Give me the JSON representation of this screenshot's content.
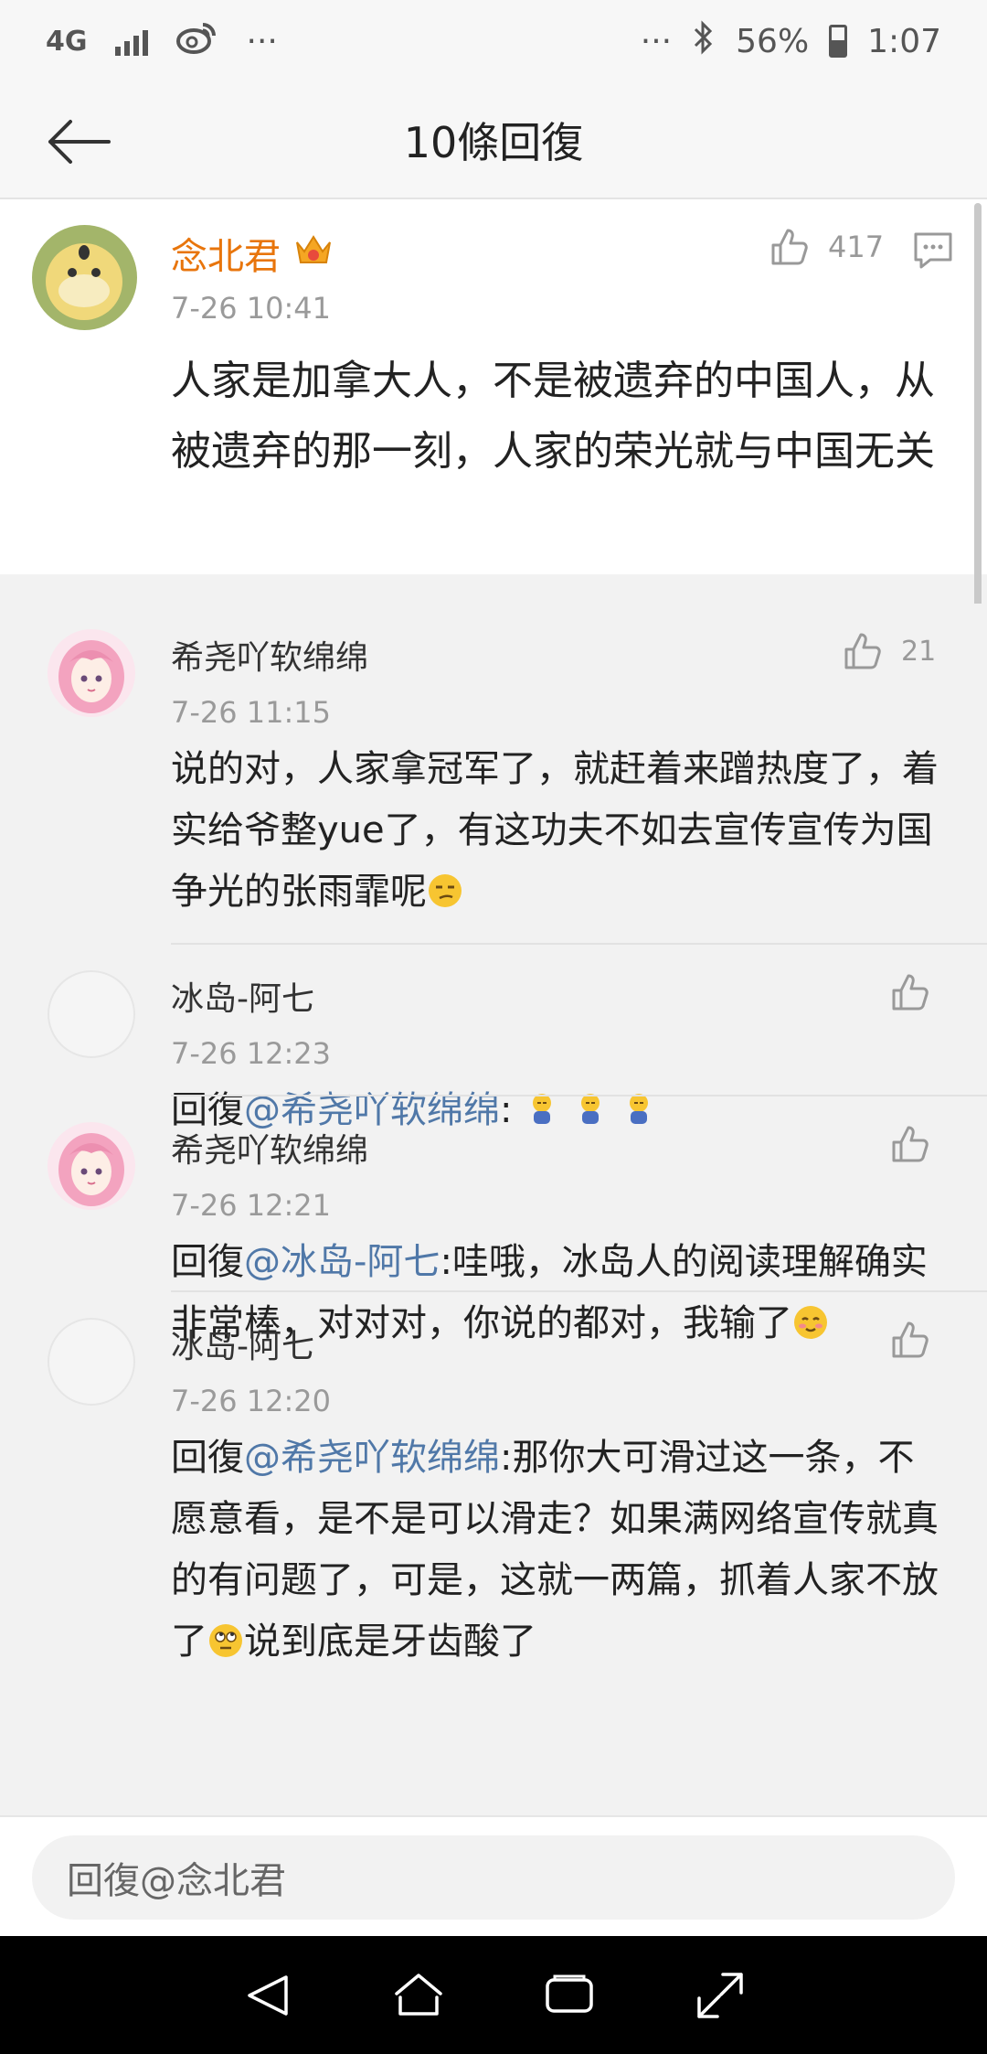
{
  "status": {
    "network": "4G",
    "battery": "56%",
    "time": "1:07",
    "dots": "···"
  },
  "header": {
    "title": "10條回復"
  },
  "main_comment": {
    "author": "念北君",
    "time": "7-26 10:41",
    "likes": "417",
    "text": "人家是加拿大人，不是被遗弃的中国人，从被遗弃的那一刻，人家的荣光就与中国无关"
  },
  "replies": [
    {
      "author": "希尧吖软绵绵",
      "time": "7-26 11:15",
      "likes": "21",
      "prefix": "",
      "mention": "",
      "text": "说的对，人家拿冠军了，就赶着来蹭热度了，着实给爷整yue了，有这功夫不如去宣传宣传为国争光的张雨霏呢",
      "emoji": "smirk-emoji"
    },
    {
      "author": "冰岛-阿七",
      "time": "7-26 12:23",
      "likes": "",
      "prefix": "回復",
      "mention": "@希尧吖软绵绵",
      "text": ":",
      "emoji": "bowing-emoji"
    },
    {
      "author": "希尧吖软绵绵",
      "time": "7-26 12:21",
      "likes": "",
      "prefix": "回復",
      "mention": "@冰岛-阿七",
      "text": ":哇哦，冰岛人的阅读理解确实非常棒，对对对，你说的都对，我输了",
      "emoji": "blushing-emoji"
    },
    {
      "author": "冰岛-阿七",
      "time": "7-26 12:20",
      "likes": "",
      "prefix": "回復",
      "mention": "@希尧吖软绵绵",
      "text": ":那你大可滑过这一条，不愿意看，是不是可以滑走？如果满网络宣传就真的有问题了，可是，这就一两篇，抓着人家不放了",
      "text_after": "说到底是牙齿酸了",
      "emoji": "eyeroll-emoji"
    }
  ],
  "reply_input": {
    "placeholder": "回復@念北君"
  }
}
